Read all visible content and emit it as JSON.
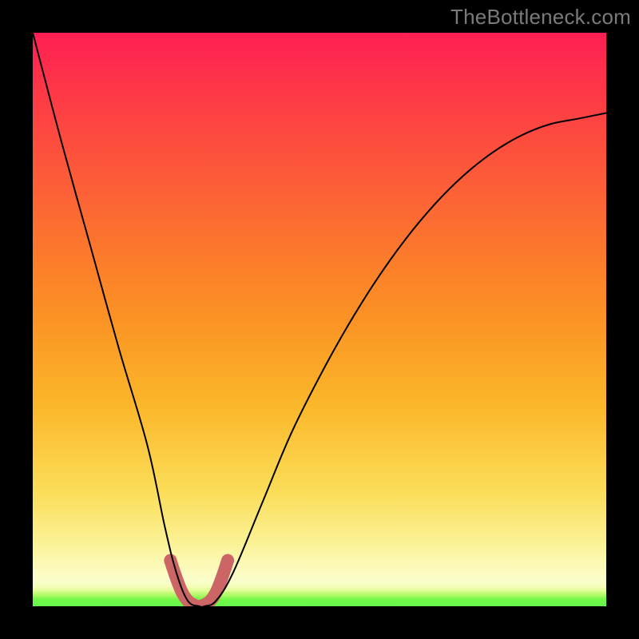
{
  "watermark": "TheBottleneck.com",
  "chart_data": {
    "type": "line",
    "title": "",
    "xlabel": "",
    "ylabel": "",
    "xlim": [
      0,
      100
    ],
    "ylim": [
      0,
      100
    ],
    "series": [
      {
        "name": "curve",
        "x": [
          0,
          5,
          10,
          15,
          20,
          23,
          25,
          27,
          29,
          30,
          32,
          35,
          40,
          45,
          50,
          55,
          60,
          65,
          70,
          75,
          80,
          85,
          90,
          95,
          100
        ],
        "y": [
          100,
          81,
          63,
          45,
          28,
          14,
          6,
          1,
          0,
          0,
          1,
          6,
          18,
          30,
          40,
          49,
          57,
          64,
          70,
          75,
          79,
          82,
          84,
          85,
          86
        ]
      },
      {
        "name": "highlight",
        "x": [
          24,
          25,
          26,
          27,
          28,
          29,
          30,
          31,
          32,
          33,
          34
        ],
        "y": [
          8,
          5,
          2.5,
          1,
          0.3,
          0,
          0.3,
          1,
          2.5,
          5,
          8
        ]
      }
    ],
    "background_gradient": {
      "stops": [
        {
          "pos": 0.0,
          "color": "#63f74a"
        },
        {
          "pos": 0.012,
          "color": "#74f848"
        },
        {
          "pos": 0.02,
          "color": "#b2fb68"
        },
        {
          "pos": 0.028,
          "color": "#e4fd9a"
        },
        {
          "pos": 0.035,
          "color": "#f7feba"
        },
        {
          "pos": 0.045,
          "color": "#fbfecc"
        },
        {
          "pos": 0.07,
          "color": "#fcfab8"
        },
        {
          "pos": 0.11,
          "color": "#fbf296"
        },
        {
          "pos": 0.2,
          "color": "#fbdd58"
        },
        {
          "pos": 0.35,
          "color": "#fbb72a"
        },
        {
          "pos": 0.5,
          "color": "#fb9324"
        },
        {
          "pos": 0.6,
          "color": "#fc7d2b"
        },
        {
          "pos": 0.7,
          "color": "#fc6634"
        },
        {
          "pos": 0.8,
          "color": "#fd4f3d"
        },
        {
          "pos": 0.88,
          "color": "#fd3c45"
        },
        {
          "pos": 0.94,
          "color": "#fe2d4c"
        },
        {
          "pos": 1.0,
          "color": "#ff1f54"
        }
      ]
    },
    "curve_color": "#000000",
    "highlight_color": "#cc6666"
  }
}
